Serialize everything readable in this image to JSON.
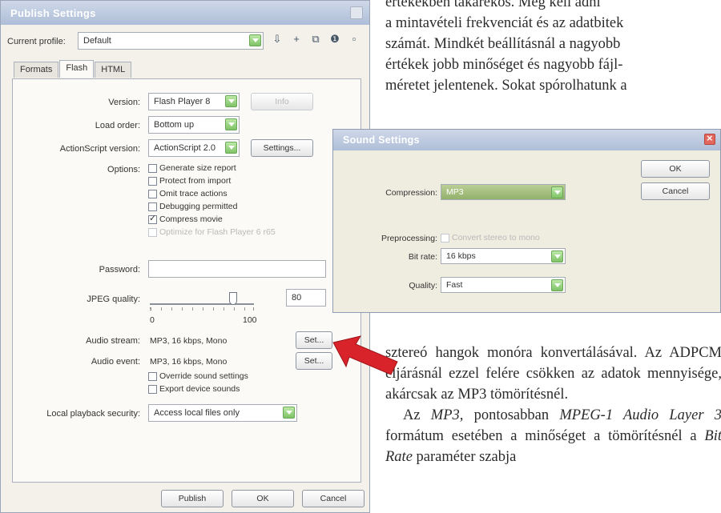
{
  "book": {
    "top_lines": [
      "értékekben takarékos. Meg kell adni",
      "a mintavételi frekvenciát és az adatbitek",
      "számát. Mindkét beállításnál a nagyobb",
      "értékek jobb minőséget és nagyobb fájl-",
      "méretet jelentenek. Sokat spórolhatunk a"
    ],
    "bottom_p1": "sztereó hangok monóra konvertálásával. Az ADPCM eljárásnál ezzel felére csökken az adatok mennyisége, akárcsak az MP3 tömörítésnél.",
    "bottom_p2_a": "Az ",
    "bottom_p2_mp3": "MP3,",
    "bottom_p2_b": " pontosabban ",
    "bottom_p2_mpeg": "MPEG-1 Audio Layer 3",
    "bottom_p2_c": " formátum esetében a minőséget a tömörítésnél a ",
    "bottom_p2_bitrate": "Bit Rate",
    "bottom_p2_d": " paraméter szabja"
  },
  "publish": {
    "title": "Publish Settings",
    "profile_label": "Current profile:",
    "profile_value": "Default",
    "tabs": [
      "Formats",
      "Flash",
      "HTML"
    ],
    "version_label": "Version:",
    "version_value": "Flash Player 8",
    "info_button": "Info",
    "load_order_label": "Load order:",
    "load_order_value": "Bottom up",
    "as_version_label": "ActionScript version:",
    "as_version_value": "ActionScript 2.0",
    "settings_button": "Settings...",
    "options_label": "Options:",
    "options": [
      {
        "label": "Generate size report",
        "checked": false,
        "disabled": false
      },
      {
        "label": "Protect from import",
        "checked": false,
        "disabled": false
      },
      {
        "label": "Omit trace actions",
        "checked": false,
        "disabled": false
      },
      {
        "label": "Debugging permitted",
        "checked": false,
        "disabled": false
      },
      {
        "label": "Compress movie",
        "checked": true,
        "disabled": false
      },
      {
        "label": "Optimize for Flash Player 6 r65",
        "checked": false,
        "disabled": true
      }
    ],
    "password_label": "Password:",
    "jpeg_label": "JPEG quality:",
    "jpeg_value": "80",
    "jpeg_level": 0.8,
    "slider_min": "0",
    "slider_max": "100",
    "audio_stream_label": "Audio stream:",
    "audio_stream_value": "MP3, 16 kbps, Mono",
    "audio_event_label": "Audio event:",
    "audio_event_value": "MP3, 16 kbps, Mono",
    "set_button": "Set...",
    "override_label": "Override sound settings",
    "export_device_label": "Export device sounds",
    "local_security_label": "Local playback security:",
    "local_security_value": "Access local files only",
    "publish_button": "Publish",
    "ok_button": "OK",
    "cancel_button": "Cancel"
  },
  "sound": {
    "title": "Sound Settings",
    "compression_label": "Compression:",
    "compression_value": "MP3",
    "preprocessing_label": "Preprocessing:",
    "preprocessing_option": "Convert stereo to mono",
    "bitrate_label": "Bit rate:",
    "bitrate_value": "16 kbps",
    "quality_label": "Quality:",
    "quality_value": "Fast",
    "ok_button": "OK",
    "cancel_button": "Cancel"
  },
  "colors": {
    "accent_green": "#7fc267",
    "arrow_red": "#d9232b",
    "titlebar": "#aebed8"
  }
}
